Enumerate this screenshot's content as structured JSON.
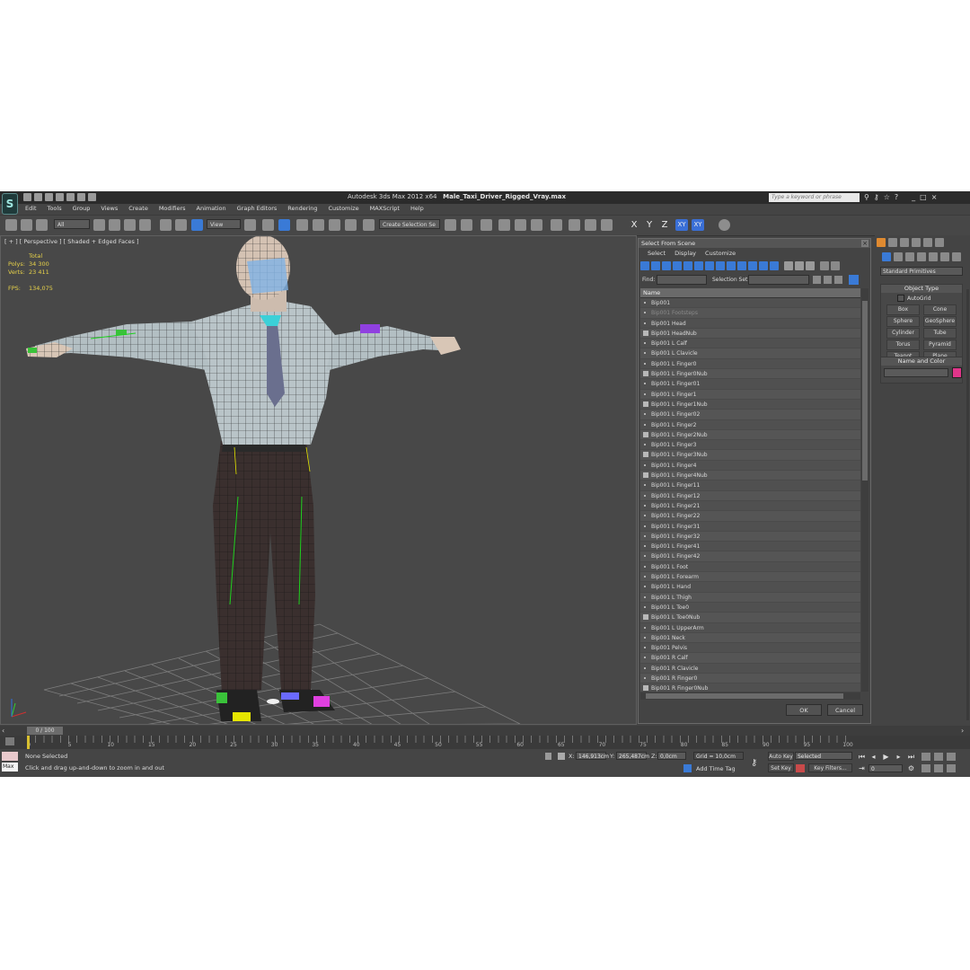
{
  "app": {
    "title_prefix": "Autodesk 3ds Max  2012 x64",
    "file_name": "Male_Taxi_Driver_Rigged_Vray.max",
    "search_placeholder": "Type a keyword or phrase",
    "logo_icon": "3dsmax-logo-icon"
  },
  "menu": [
    "Edit",
    "Tools",
    "Group",
    "Views",
    "Create",
    "Modifiers",
    "Animation",
    "Graph Editors",
    "Rendering",
    "Customize",
    "MAXScript",
    "Help"
  ],
  "toolbar": {
    "filter_value": "All",
    "refcoord_value": "View",
    "selection_set_placeholder": "Create Selection Se",
    "axes": [
      "X",
      "Y",
      "Z",
      "XY",
      "XY"
    ]
  },
  "viewport": {
    "label": "[ + ] [ Perspective ] [ Shaded + Edged Faces ]",
    "stats_header": "Total",
    "stats": [
      {
        "k": "Polys:",
        "v": "34 300"
      },
      {
        "k": "Verts:",
        "v": "23 411"
      }
    ],
    "fps_label": "FPS:",
    "fps_value": "134,075"
  },
  "dialog": {
    "title": "Select From Scene",
    "menu": [
      "Select",
      "Display",
      "Customize"
    ],
    "find_label": "Find:",
    "selset_label": "Selection Set:",
    "column_name": "Name",
    "items": [
      {
        "name": "Bip001",
        "icon": "dot"
      },
      {
        "name": "Bip001 Footsteps",
        "icon": "dot",
        "dim": true
      },
      {
        "name": "Bip001 Head",
        "icon": "dot"
      },
      {
        "name": "Bip001 HeadNub",
        "icon": "nub"
      },
      {
        "name": "Bip001 L Calf",
        "icon": "dot"
      },
      {
        "name": "Bip001 L Clavicle",
        "icon": "dot"
      },
      {
        "name": "Bip001 L Finger0",
        "icon": "dot"
      },
      {
        "name": "Bip001 L Finger0Nub",
        "icon": "nub"
      },
      {
        "name": "Bip001 L Finger01",
        "icon": "dot"
      },
      {
        "name": "Bip001 L Finger1",
        "icon": "dot"
      },
      {
        "name": "Bip001 L Finger1Nub",
        "icon": "nub"
      },
      {
        "name": "Bip001 L Finger02",
        "icon": "dot"
      },
      {
        "name": "Bip001 L Finger2",
        "icon": "dot"
      },
      {
        "name": "Bip001 L Finger2Nub",
        "icon": "nub"
      },
      {
        "name": "Bip001 L Finger3",
        "icon": "dot"
      },
      {
        "name": "Bip001 L Finger3Nub",
        "icon": "nub"
      },
      {
        "name": "Bip001 L Finger4",
        "icon": "dot"
      },
      {
        "name": "Bip001 L Finger4Nub",
        "icon": "nub"
      },
      {
        "name": "Bip001 L Finger11",
        "icon": "dot"
      },
      {
        "name": "Bip001 L Finger12",
        "icon": "dot"
      },
      {
        "name": "Bip001 L Finger21",
        "icon": "dot"
      },
      {
        "name": "Bip001 L Finger22",
        "icon": "dot"
      },
      {
        "name": "Bip001 L Finger31",
        "icon": "dot"
      },
      {
        "name": "Bip001 L Finger32",
        "icon": "dot"
      },
      {
        "name": "Bip001 L Finger41",
        "icon": "dot"
      },
      {
        "name": "Bip001 L Finger42",
        "icon": "dot"
      },
      {
        "name": "Bip001 L Foot",
        "icon": "dot"
      },
      {
        "name": "Bip001 L Forearm",
        "icon": "dot"
      },
      {
        "name": "Bip001 L Hand",
        "icon": "dot"
      },
      {
        "name": "Bip001 L Thigh",
        "icon": "dot"
      },
      {
        "name": "Bip001 L Toe0",
        "icon": "dot"
      },
      {
        "name": "Bip001 L Toe0Nub",
        "icon": "nub"
      },
      {
        "name": "Bip001 L UpperArm",
        "icon": "dot"
      },
      {
        "name": "Bip001 Neck",
        "icon": "dot"
      },
      {
        "name": "Bip001 Pelvis",
        "icon": "dot"
      },
      {
        "name": "Bip001 R Calf",
        "icon": "dot"
      },
      {
        "name": "Bip001 R Clavicle",
        "icon": "dot"
      },
      {
        "name": "Bip001 R Finger0",
        "icon": "dot"
      },
      {
        "name": "Bip001 R Finger0Nub",
        "icon": "nub"
      }
    ],
    "ok_label": "OK",
    "cancel_label": "Cancel"
  },
  "command_panel": {
    "category_value": "Standard Primitives",
    "object_type_title": "Object Type",
    "autogrid_label": "AutoGrid",
    "primitives": [
      "Box",
      "Cone",
      "Sphere",
      "GeoSphere",
      "Cylinder",
      "Tube",
      "Torus",
      "Pyramid",
      "Teapot",
      "Plane"
    ],
    "name_color_title": "Name and Color",
    "object_color": "#e0358a"
  },
  "timeline": {
    "frame_display": "0 / 100",
    "ruler_labels": [
      "0",
      "5",
      "10",
      "15",
      "20",
      "25",
      "30",
      "35",
      "40",
      "45",
      "50",
      "55",
      "60",
      "65",
      "70",
      "75",
      "80",
      "85",
      "90",
      "95",
      "100"
    ]
  },
  "status": {
    "script_label": "Max",
    "selection_text": "None Selected",
    "prompt_text": "Click and drag up-and-down to zoom in and out",
    "x_label": "X:",
    "x_value": "146,913cm",
    "y_label": "Y:",
    "y_value": "265,487cm",
    "z_label": "Z:",
    "z_value": "0,0cm",
    "grid_text": "Grid = 10,0cm",
    "add_time_tag": "Add Time Tag",
    "auto_key": "Auto Key",
    "selected_value": "Selected",
    "set_key": "Set Key",
    "key_filters": "Key Filters...",
    "frame_value": "0"
  }
}
